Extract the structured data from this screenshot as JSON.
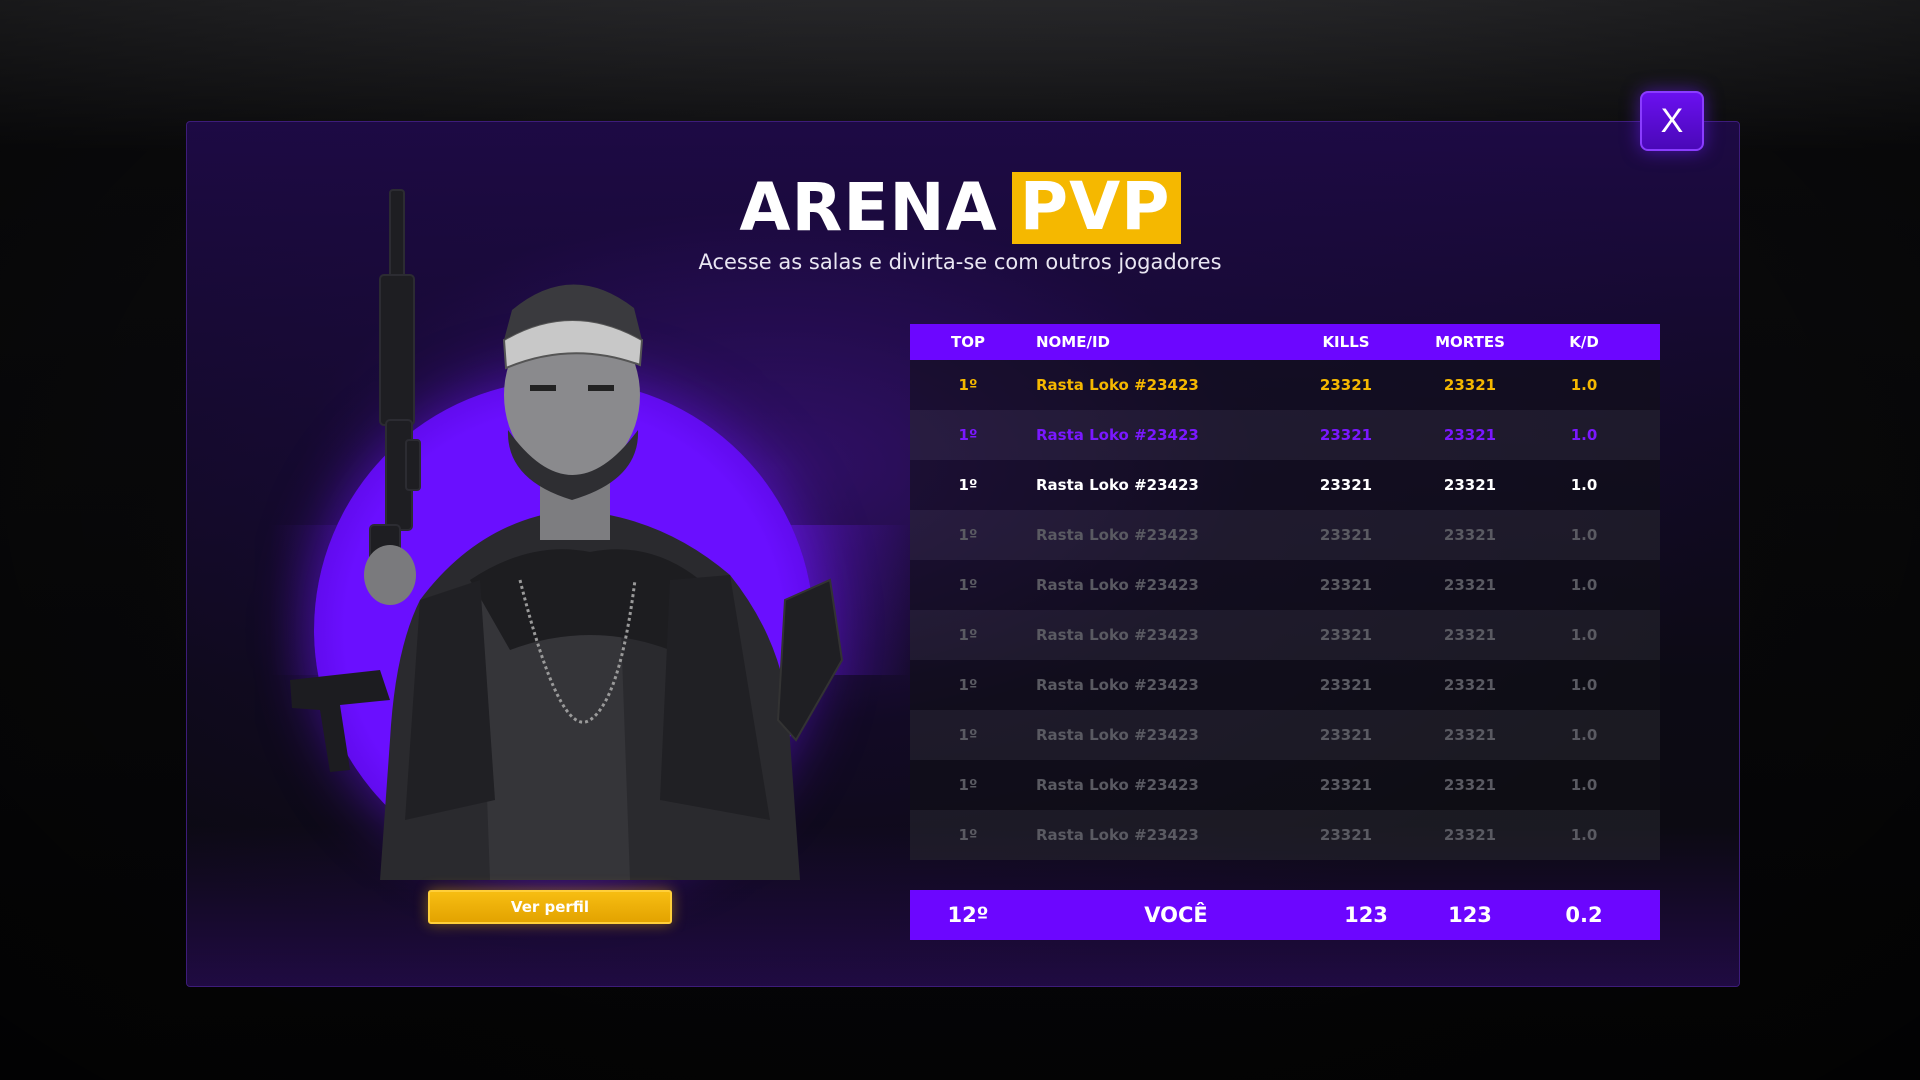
{
  "header": {
    "title_main": "ARENA",
    "title_highlight": "PVP",
    "subtitle": "Acesse as salas e divirta-se com outros jogadores",
    "close_label": "X"
  },
  "profile": {
    "button_label": "Ver perfil"
  },
  "colors": {
    "accent_purple": "#6c06ff",
    "accent_gold": "#f5b800",
    "background": "#0c0a14"
  },
  "leaderboard": {
    "columns": [
      "TOP",
      "NOME/ID",
      "KILLS",
      "MORTES",
      "K/D"
    ],
    "rows": [
      {
        "rank": "1º",
        "name": "Rasta Loko #23423",
        "kills": "23321",
        "deaths": "23321",
        "kd": "1.0"
      },
      {
        "rank": "1º",
        "name": "Rasta Loko #23423",
        "kills": "23321",
        "deaths": "23321",
        "kd": "1.0"
      },
      {
        "rank": "1º",
        "name": "Rasta Loko #23423",
        "kills": "23321",
        "deaths": "23321",
        "kd": "1.0"
      },
      {
        "rank": "1º",
        "name": "Rasta Loko #23423",
        "kills": "23321",
        "deaths": "23321",
        "kd": "1.0"
      },
      {
        "rank": "1º",
        "name": "Rasta Loko #23423",
        "kills": "23321",
        "deaths": "23321",
        "kd": "1.0"
      },
      {
        "rank": "1º",
        "name": "Rasta Loko #23423",
        "kills": "23321",
        "deaths": "23321",
        "kd": "1.0"
      },
      {
        "rank": "1º",
        "name": "Rasta Loko #23423",
        "kills": "23321",
        "deaths": "23321",
        "kd": "1.0"
      },
      {
        "rank": "1º",
        "name": "Rasta Loko #23423",
        "kills": "23321",
        "deaths": "23321",
        "kd": "1.0"
      },
      {
        "rank": "1º",
        "name": "Rasta Loko #23423",
        "kills": "23321",
        "deaths": "23321",
        "kd": "1.0"
      },
      {
        "rank": "1º",
        "name": "Rasta Loko #23423",
        "kills": "23321",
        "deaths": "23321",
        "kd": "1.0"
      }
    ],
    "you": {
      "rank": "12º",
      "name": "VOCÊ",
      "kills": "123",
      "deaths": "123",
      "kd": "0.2"
    }
  }
}
